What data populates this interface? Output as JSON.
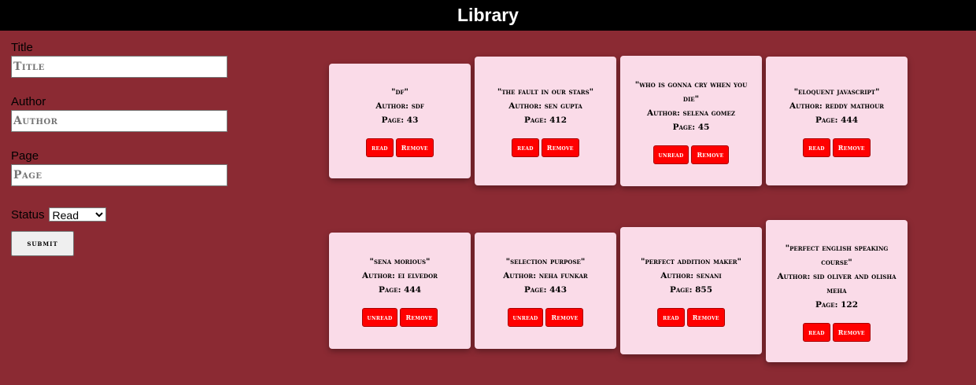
{
  "header": {
    "title": "Library"
  },
  "form": {
    "title_label": "Title",
    "title_placeholder": "Title",
    "author_label": "Author",
    "author_placeholder": "Author",
    "page_label": "Page",
    "page_placeholder": "Page",
    "status_label": "Status",
    "status_value": "Read",
    "submit_label": "submit"
  },
  "books": [
    {
      "title": "\"df\"",
      "author": "Author: sdf",
      "page": "Page: 43",
      "status_btn": "read",
      "remove_btn": "Remove"
    },
    {
      "title": "\"the fault in our stars\"",
      "author": "Author: sen gupta",
      "page": "Page: 412",
      "status_btn": "read",
      "remove_btn": "Remove"
    },
    {
      "title": "\"who is gonna cry when you die\"",
      "author": "Author: selena gomez",
      "page": "Page: 45",
      "status_btn": "unread",
      "remove_btn": "Remove"
    },
    {
      "title": "\"eloquent javascript\"",
      "author": "Author: reddy mathour",
      "page": "Page: 444",
      "status_btn": "read",
      "remove_btn": "Remove"
    },
    {
      "title": "\"sena morious\"",
      "author": "Author: ei elvedor",
      "page": "Page: 444",
      "status_btn": "unread",
      "remove_btn": "Remove"
    },
    {
      "title": "\"selection purpose\"",
      "author": "Author: neha funkar",
      "page": "Page: 443",
      "status_btn": "unread",
      "remove_btn": "Remove"
    },
    {
      "title": "\"perfect addition maker\"",
      "author": "Author: senani",
      "page": "Page: 855",
      "status_btn": "read",
      "remove_btn": "Remove"
    },
    {
      "title": "\"perfect english speaking course\"",
      "author": "Author: sid oliver and olisha meha",
      "page": "Page: 122",
      "status_btn": "read",
      "remove_btn": "Remove"
    }
  ]
}
